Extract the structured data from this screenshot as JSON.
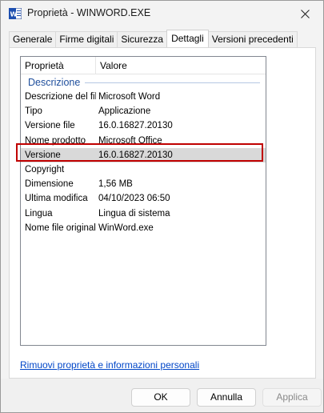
{
  "window": {
    "title": "Proprietà - WINWORD.EXE",
    "accent": "#c00000"
  },
  "tabs": [
    {
      "label": "Generale"
    },
    {
      "label": "Firme digitali"
    },
    {
      "label": "Sicurezza"
    },
    {
      "label": "Dettagli"
    },
    {
      "label": "Versioni precedenti"
    }
  ],
  "details": {
    "columns": {
      "property": "Proprietà",
      "value": "Valore"
    },
    "group": "Descrizione",
    "rows": [
      {
        "key": "Descrizione del file",
        "value": "Microsoft Word"
      },
      {
        "key": "Tipo",
        "value": "Applicazione"
      },
      {
        "key": "Versione file",
        "value": "16.0.16827.20130"
      },
      {
        "key": "Nome prodotto",
        "value": "Microsoft Office"
      },
      {
        "key": "Versione",
        "value": "16.0.16827.20130"
      },
      {
        "key": "Copyright",
        "value": ""
      },
      {
        "key": "Dimensione",
        "value": "1,56 MB"
      },
      {
        "key": "Ultima modifica",
        "value": "04/10/2023 06:50"
      },
      {
        "key": "Lingua",
        "value": "Lingua di sistema"
      },
      {
        "key": "Nome file originale",
        "value": "WinWord.exe"
      }
    ]
  },
  "link": "Rimuovi proprietà e informazioni personali",
  "buttons": {
    "ok": "OK",
    "cancel": "Annulla",
    "apply": "Applica"
  }
}
